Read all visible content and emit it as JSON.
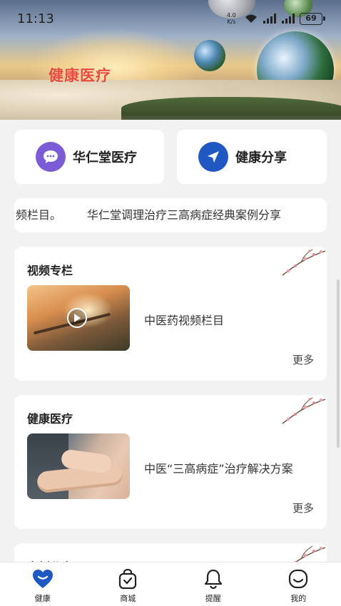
{
  "status_bar": {
    "time": "11:13",
    "net_speed_value": "4.0",
    "net_speed_unit": "K/s",
    "battery": "69"
  },
  "hero": {
    "title": "健康医疗",
    "title_color": "#e84a3c"
  },
  "quick_actions": [
    {
      "label": "华仁堂医疗",
      "icon": "chat-bubble-icon",
      "color": "#7b5cd6"
    },
    {
      "label": "健康分享",
      "icon": "send-arrow-icon",
      "color": "#1f57c3"
    }
  ],
  "marquee": {
    "text_tail": "频栏目。",
    "text": "华仁堂调理治疗三高病症经典案例分享"
  },
  "sections": [
    {
      "title": "视频专栏",
      "item_title": "中医药视频栏目",
      "more_label": "更多",
      "thumb": "video-thumbnail"
    },
    {
      "title": "健康医疗",
      "item_title": "中医“三高病症”治疗解决方案",
      "more_label": "更多",
      "thumb": "pulse-diagnosis-thumbnail"
    },
    {
      "title": "案例分享"
    }
  ],
  "tabbar": {
    "active_color": "#1f57c3",
    "tabs": [
      {
        "label": "健康",
        "icon": "heart-icon",
        "active": true
      },
      {
        "label": "商城",
        "icon": "shopping-bag-icon",
        "active": false
      },
      {
        "label": "提醒",
        "icon": "bell-icon",
        "active": false
      },
      {
        "label": "我的",
        "icon": "smile-face-icon",
        "active": false
      }
    ]
  }
}
